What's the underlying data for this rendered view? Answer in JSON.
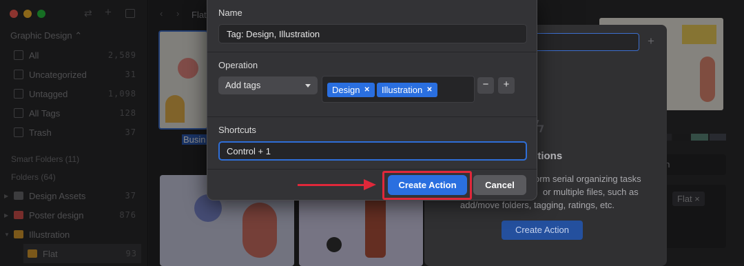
{
  "window": {
    "colors": {
      "close": "#ff5f57",
      "minimize": "#febc2e",
      "maximize": "#28c840"
    }
  },
  "sidebar": {
    "library": "Graphic Design",
    "items": [
      {
        "label": "All",
        "count": "2,589",
        "icon": "all-icon"
      },
      {
        "label": "Uncategorized",
        "count": "31",
        "icon": "uncategorized-icon"
      },
      {
        "label": "Untagged",
        "count": "1,098",
        "icon": "untagged-icon"
      },
      {
        "label": "All Tags",
        "count": "128",
        "icon": "tag-icon"
      },
      {
        "label": "Trash",
        "count": "37",
        "icon": "trash-icon"
      }
    ],
    "smart_folders": "Smart Folders (11)",
    "folders_header": "Folders (64)",
    "folders": [
      {
        "label": "Design Assets",
        "count": "37",
        "color": "#6e6e72"
      },
      {
        "label": "Poster design",
        "count": "876",
        "color": "#d9534f"
      },
      {
        "label": "Illustration",
        "count": "",
        "color": "#e0a030"
      },
      {
        "label": "Flat",
        "count": "93",
        "color": "#e0a030"
      }
    ]
  },
  "main": {
    "breadcrumb": "Flat",
    "selected_label": "Busin"
  },
  "background_panel": {
    "title": "ctions",
    "desc_line1": "orm serial organizing tasks",
    "desc_line2": "or multiple files, such as",
    "desc_line3": "add/move folders, tagging, ratings, etc.",
    "button": "Create Action"
  },
  "right_panel": {
    "chip": "Flat",
    "field_partial": "an"
  },
  "dialog": {
    "name_label": "Name",
    "name_value": "Tag: Design, Illustration",
    "operation_label": "Operation",
    "operation_select": "Add tags",
    "tags": [
      "Design",
      "Illustration"
    ],
    "remove_label": "−",
    "add_label": "+",
    "shortcuts_label": "Shortcuts",
    "shortcut_value": "Control + 1",
    "create_label": "Create Action",
    "cancel_label": "Cancel",
    "accent": "#2a6fe0",
    "highlight_color": "#e0283a"
  }
}
